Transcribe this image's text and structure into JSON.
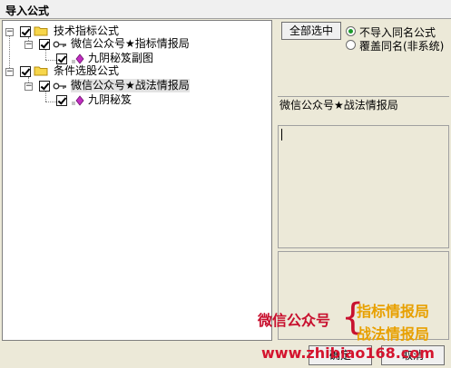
{
  "window": {
    "title": "导入公式"
  },
  "tree": {
    "groups": [
      {
        "label": "技术指标公式",
        "formula": {
          "label": "微信公众号★指标情报局",
          "child": "九阴秘笈副图"
        }
      },
      {
        "label": "条件选股公式",
        "formula": {
          "label": "微信公众号★战法情报局",
          "child": "九阴秘笈"
        }
      }
    ]
  },
  "options": {
    "select_all_label": "全部选中",
    "no_import_same_name": "不导入同名公式",
    "overwrite_same_name": "覆盖同名(非系统)"
  },
  "formula_name": "微信公众号★战法情报局",
  "buttons": {
    "ok": "确定",
    "cancel": "取消"
  },
  "watermark": {
    "left": "微信公众号",
    "brace": "{",
    "top_right": "指标情报局",
    "bottom_right": "战法情报局",
    "url": "www.zhibiao168.com"
  }
}
